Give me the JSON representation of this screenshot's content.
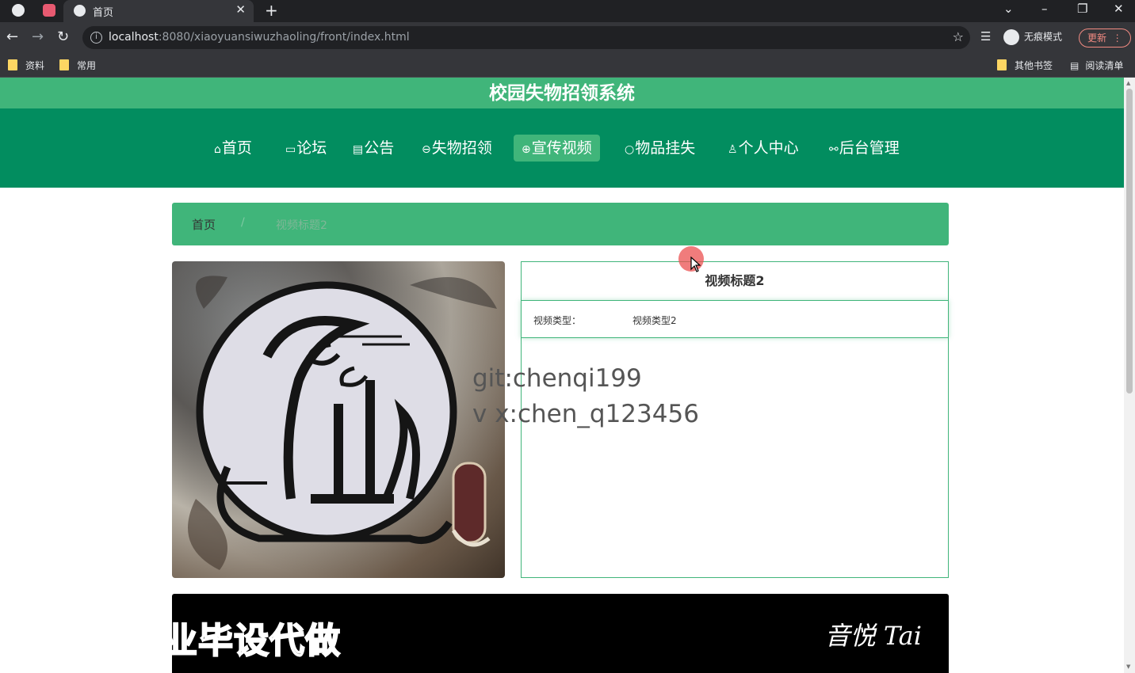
{
  "browser": {
    "tab_title": "首页",
    "url_host": "localhost",
    "url_rest": ":8080/xiaoyuansiwuzhaoling/front/index.html",
    "incognito_label": "无痕模式",
    "update_label": "更新",
    "bookmarks": [
      "资料",
      "常用"
    ],
    "bookmarks_right": [
      "其他书签",
      "阅读清单"
    ]
  },
  "site": {
    "title": "校园失物招领系统",
    "nav": [
      {
        "icon": "⌂",
        "label": "首页"
      },
      {
        "icon": "▭",
        "label": "论坛"
      },
      {
        "icon": "▤",
        "label": "公告"
      },
      {
        "icon": "⊖",
        "label": "失物招领"
      },
      {
        "icon": "⊕",
        "label": "宣传视频"
      },
      {
        "icon": "○",
        "label": "物品挂失"
      },
      {
        "icon": "♙",
        "label": "个人中心"
      },
      {
        "icon": "⚯",
        "label": "后台管理"
      }
    ],
    "active_nav": "宣传视频"
  },
  "breadcrumb": {
    "home": "首页",
    "separator": "/",
    "current": "视频标题2"
  },
  "detail": {
    "title": "视频标题2",
    "type_label": "视频类型：",
    "type_value": "视频类型2"
  },
  "watermark": {
    "line1": "git:chenqi199",
    "line2": "v x:chen_q123456"
  },
  "video": {
    "brand": "音悦 Tai"
  },
  "overlay_ad": "专业毕设代做",
  "colors": {
    "title_bar": "#40b57a",
    "nav_bar": "#028d5f",
    "accent": "#40b57a"
  }
}
